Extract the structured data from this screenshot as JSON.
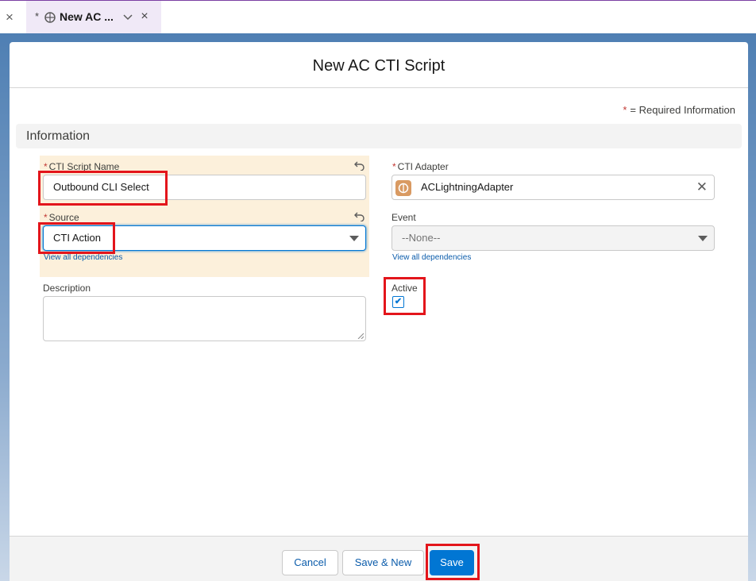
{
  "tab": {
    "unsaved_marker": "*",
    "title": "New AC ...",
    "icon": "cti-script-icon"
  },
  "modal": {
    "title": "New AC CTI Script",
    "required_marker": "*",
    "required_info": "= Required Information",
    "section_title": "Information"
  },
  "fields": {
    "cti_script_name": {
      "required": "*",
      "label": "CTI Script Name",
      "value": "Outbound CLI Select"
    },
    "source": {
      "required": "*",
      "label": "Source",
      "value": "CTI Action",
      "dependencies_link": "View all dependencies"
    },
    "description": {
      "label": "Description",
      "value": ""
    },
    "cti_adapter": {
      "required": "*",
      "label": "CTI Adapter",
      "value": "ACLightningAdapter"
    },
    "event": {
      "label": "Event",
      "value": "--None--",
      "dependencies_link": "View all dependencies"
    },
    "active": {
      "label": "Active",
      "checked": true,
      "check_glyph": "✔"
    }
  },
  "footer": {
    "cancel_label": "Cancel",
    "save_new_label": "Save & New",
    "save_label": "Save"
  },
  "colors": {
    "brand": "#0176d3",
    "edited_field_bg": "#fcf0db",
    "highlight": "#e3151b",
    "required_star": "#c23934"
  }
}
